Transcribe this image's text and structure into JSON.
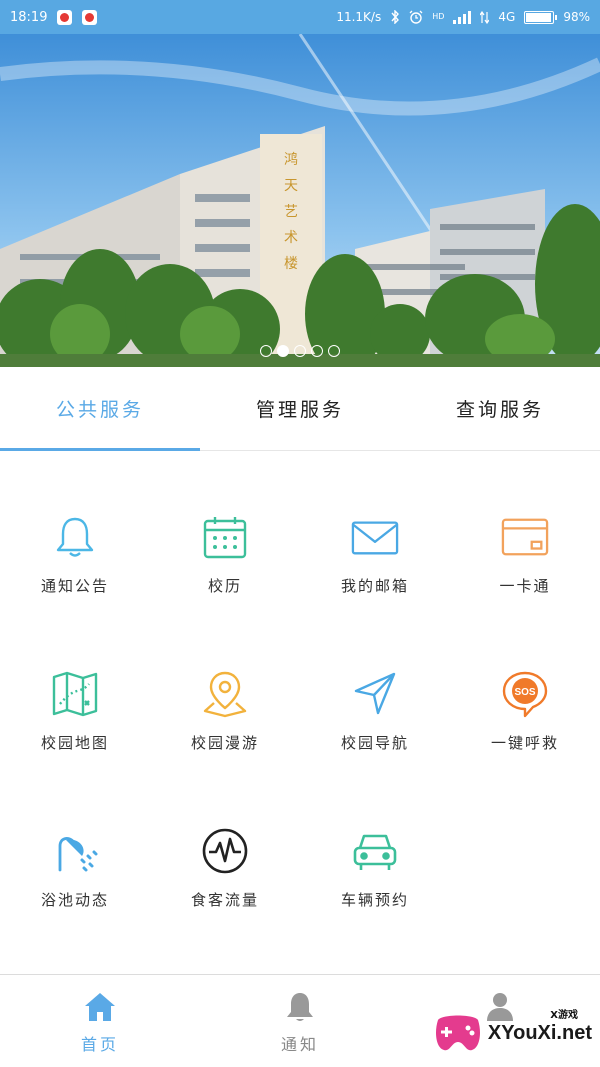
{
  "status_bar": {
    "time": "18:19",
    "network_speed": "11.1K/s",
    "network_type": "4G",
    "hd_label": "HD",
    "battery": "98%"
  },
  "banner": {
    "building_sign": "鸿天艺术楼",
    "slide_count": 5,
    "active_slide": 2
  },
  "tabs": [
    {
      "label": "公共服务",
      "active": true
    },
    {
      "label": "管理服务",
      "active": false
    },
    {
      "label": "查询服务",
      "active": false
    }
  ],
  "services": [
    {
      "label": "通知公告",
      "icon": "bell-icon",
      "color": "#4cb7e6"
    },
    {
      "label": "校历",
      "icon": "calendar-icon",
      "color": "#3cbf9a"
    },
    {
      "label": "我的邮箱",
      "icon": "mail-icon",
      "color": "#4aa8e4"
    },
    {
      "label": "一卡通",
      "icon": "card-icon",
      "color": "#f2a25c"
    },
    {
      "label": "校园地图",
      "icon": "map-icon",
      "color": "#3cbf9a"
    },
    {
      "label": "校园漫游",
      "icon": "location-pin-icon",
      "color": "#f2b23c"
    },
    {
      "label": "校园导航",
      "icon": "navigation-arrow-icon",
      "color": "#4aa8e4"
    },
    {
      "label": "一键呼救",
      "icon": "sos-icon",
      "color": "#f07a2a"
    },
    {
      "label": "浴池动态",
      "icon": "shower-icon",
      "color": "#4aa8e4"
    },
    {
      "label": "食客流量",
      "icon": "pulse-icon",
      "color": "#222222"
    },
    {
      "label": "车辆预约",
      "icon": "car-icon",
      "color": "#3cbf9a"
    }
  ],
  "bottom_nav": [
    {
      "label": "首页",
      "icon": "home-icon",
      "active": true
    },
    {
      "label": "通知",
      "icon": "bell-icon",
      "active": false
    },
    {
      "label": "",
      "icon": "user-icon",
      "active": false
    }
  ],
  "watermark": {
    "small": "X游戏",
    "text": "XYouXi.net"
  },
  "colors": {
    "accent": "#5aa9e6",
    "status_bar": "#58a8e2"
  }
}
